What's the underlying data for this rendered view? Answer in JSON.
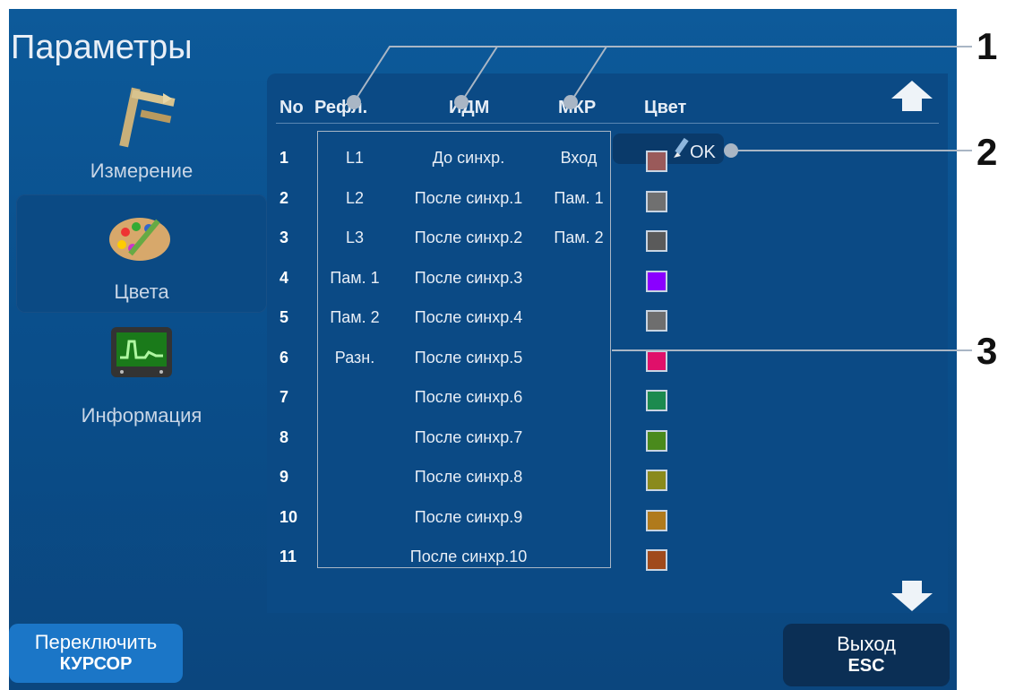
{
  "title": "Параметры",
  "sidebar": {
    "items": [
      {
        "label": "Измерение",
        "icon": "caliper-icon"
      },
      {
        "label": "Цвета",
        "icon": "palette-icon"
      },
      {
        "label": "Информация",
        "icon": "oscilloscope-icon"
      }
    ]
  },
  "table": {
    "headers": {
      "no": "No",
      "refl": "Рефл.",
      "idm": "ИДМ",
      "mkr": "МКР",
      "color": "Цвет"
    },
    "rows": [
      {
        "num": "1",
        "refl": "L1",
        "idm": "До синхр.",
        "mkr": "Вход",
        "color": "#9a5a5a"
      },
      {
        "num": "2",
        "refl": "L2",
        "idm": "После синхр.1",
        "mkr": "Пам. 1",
        "color": "#707070"
      },
      {
        "num": "3",
        "refl": "L3",
        "idm": "После синхр.2",
        "mkr": "Пам. 2",
        "color": "#5a5a5a"
      },
      {
        "num": "4",
        "refl": "Пам. 1",
        "idm": "После синхр.3",
        "mkr": "",
        "color": "#8a00ff"
      },
      {
        "num": "5",
        "refl": "Пам. 2",
        "idm": "После синхр.4",
        "mkr": "",
        "color": "#6e6e6e"
      },
      {
        "num": "6",
        "refl": "Разн.",
        "idm": "После синхр.5",
        "mkr": "",
        "color": "#e0106a"
      },
      {
        "num": "7",
        "refl": "",
        "idm": "После синхр.6",
        "mkr": "",
        "color": "#1c8a4e"
      },
      {
        "num": "8",
        "refl": "",
        "idm": "После синхр.7",
        "mkr": "",
        "color": "#4a8a1c"
      },
      {
        "num": "9",
        "refl": "",
        "idm": "После синхр.8",
        "mkr": "",
        "color": "#8a8a1c"
      },
      {
        "num": "10",
        "refl": "",
        "idm": "После синхр.9",
        "mkr": "",
        "color": "#b07a1c"
      },
      {
        "num": "11",
        "refl": "",
        "idm": "После синхр.10",
        "mkr": "",
        "color": "#a04a1c"
      }
    ]
  },
  "edit": {
    "ok_label": "OK",
    "icon": "pencil-icon"
  },
  "scroll": {
    "up_icon": "arrow-up-icon",
    "down_icon": "arrow-down-icon"
  },
  "buttons": {
    "switch": {
      "line1": "Переключить",
      "line2": "КУРСОР"
    },
    "exit": {
      "line1": "Выход",
      "line2": "ESC"
    }
  },
  "annotations": [
    "1",
    "2",
    "3"
  ],
  "colors": {
    "accent": "#0b4a85",
    "button_left": "#1b76c7",
    "button_exit": "#0b2f55"
  }
}
